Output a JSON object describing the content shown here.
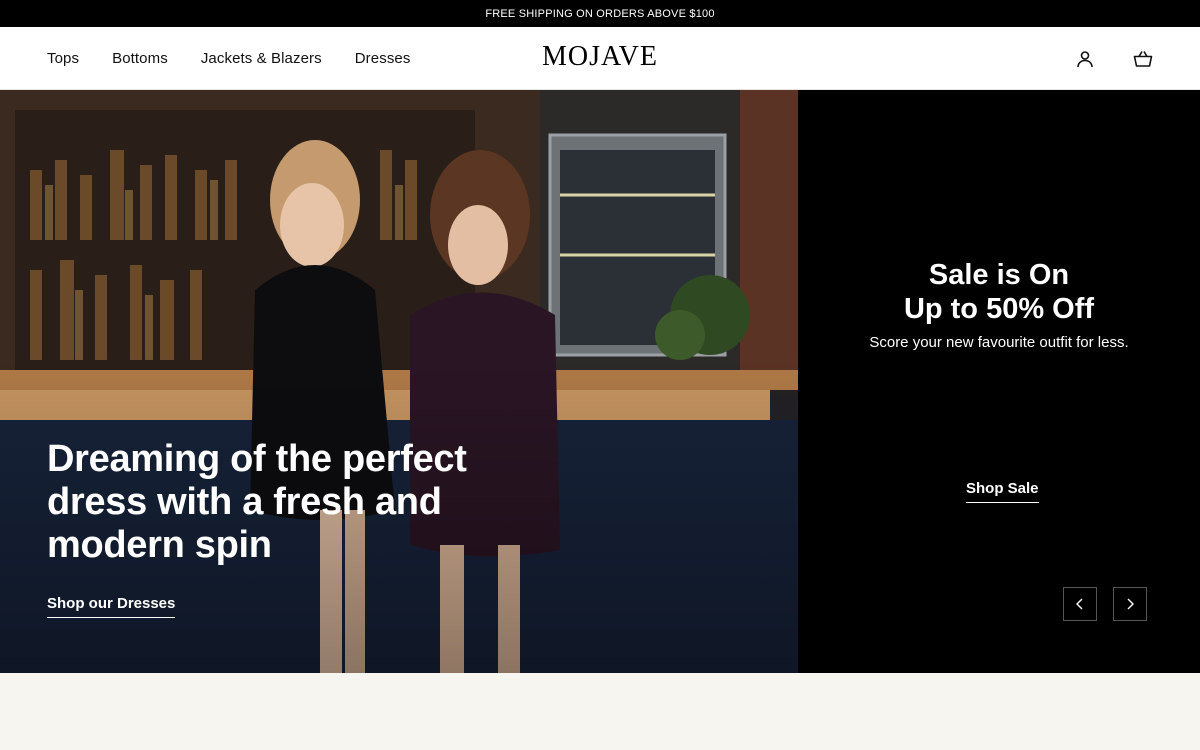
{
  "announcement": {
    "text": "FREE SHIPPING ON ORDERS ABOVE $100"
  },
  "header": {
    "nav": [
      {
        "label": "Tops"
      },
      {
        "label": "Bottoms"
      },
      {
        "label": "Jackets & Blazers"
      },
      {
        "label": "Dresses"
      }
    ],
    "logo": "MOJAVE",
    "icons": [
      "account-icon",
      "cart-icon"
    ]
  },
  "hero": {
    "headline": "Dreaming of the perfect dress with a fresh and modern spin",
    "link": "Shop our Dresses"
  },
  "promo": {
    "title_line1": "Sale is On",
    "title_line2": "Up to 50% Off",
    "subtitle": "Score your new favourite outfit for less.",
    "link": "Shop Sale",
    "arrows": [
      "chevron-left-icon",
      "chevron-right-icon"
    ]
  },
  "colors": {
    "bar": "#000000",
    "page_bg": "#f7f5f0",
    "text_light": "#ffffff"
  }
}
